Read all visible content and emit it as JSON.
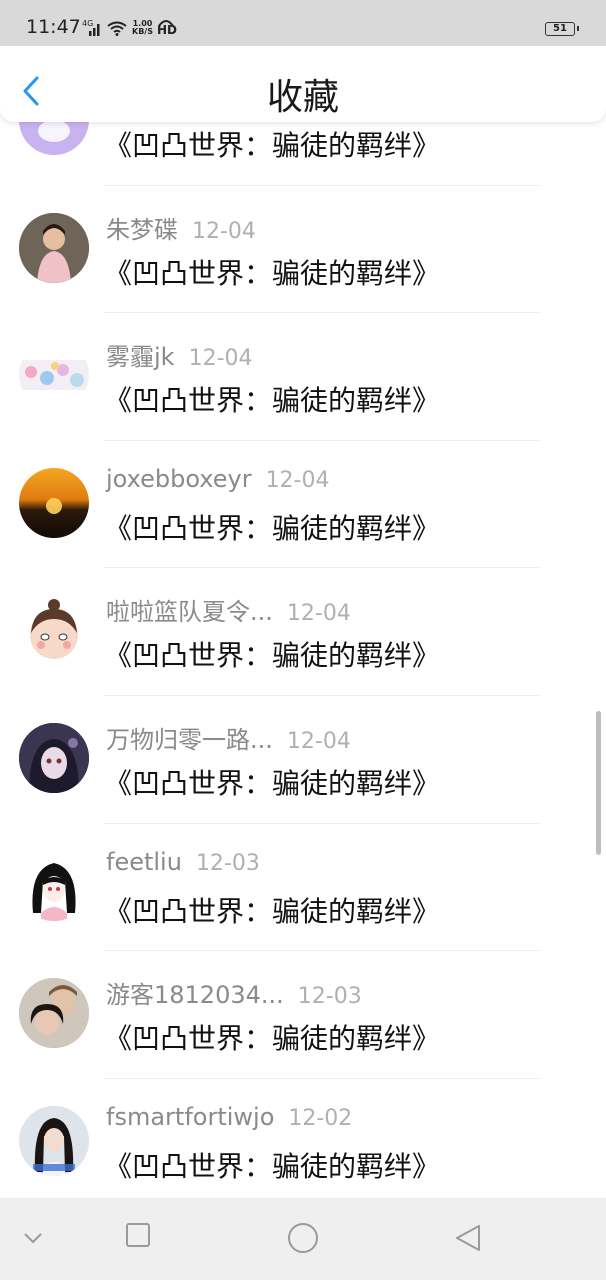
{
  "status_bar": {
    "time": "11:47",
    "network": "4G",
    "speed_value": "1.00",
    "speed_unit": "KB/S",
    "hd": "HD",
    "battery": "51"
  },
  "header": {
    "title": "收藏",
    "back_icon": "chevron-left-icon"
  },
  "accent_color": "#2196f3",
  "items": [
    {
      "name": "",
      "date": "",
      "book": "《凹凸世界：骗徒的羁绊》",
      "avatar": "avatar-partial"
    },
    {
      "name": "朱梦碟",
      "date": "12-04",
      "book": "《凹凸世界：骗徒的羁绊》",
      "avatar": "avatar-photo-girl"
    },
    {
      "name": "雾霾jk",
      "date": "12-04",
      "book": "《凹凸世界：骗徒的羁绊》",
      "avatar": "avatar-illustration"
    },
    {
      "name": "joxebboxeyr",
      "date": "12-04",
      "book": "《凹凸世界：骗徒的羁绊》",
      "avatar": "avatar-sunset"
    },
    {
      "name": "啦啦篮队夏令...",
      "date": "12-04",
      "book": "《凹凸世界：骗徒的羁绊》",
      "avatar": "avatar-cartoon"
    },
    {
      "name": "万物归零一路...",
      "date": "12-04",
      "book": "《凹凸世界：骗徒的羁绊》",
      "avatar": "avatar-anime-dark"
    },
    {
      "name": "feetliu",
      "date": "12-03",
      "book": "《凹凸世界：骗徒的羁绊》",
      "avatar": "avatar-anime-girl"
    },
    {
      "name": "游客1812034...",
      "date": "12-03",
      "book": "《凹凸世界：骗徒的羁绊》",
      "avatar": "avatar-photo-couple"
    },
    {
      "name": "fsmartfortiwjo",
      "date": "12-02",
      "book": "《凹凸世界：骗徒的羁绊》",
      "avatar": "avatar-photo-portrait"
    }
  ],
  "nav": {
    "icons": [
      "chevron-down-icon",
      "square-icon",
      "circle-icon",
      "triangle-back-icon"
    ]
  }
}
